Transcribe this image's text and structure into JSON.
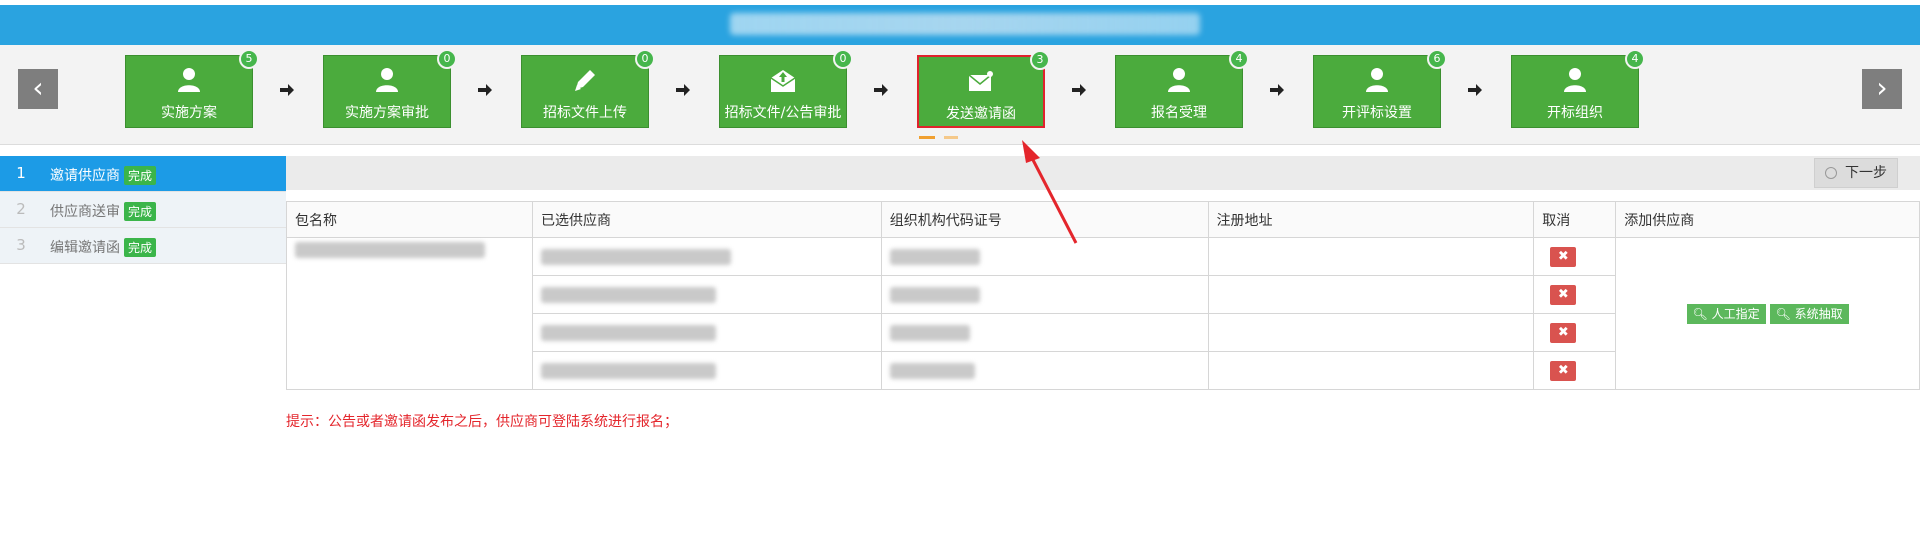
{
  "steps": [
    {
      "label": "实施方案",
      "badge": "5",
      "icon": "user-icon"
    },
    {
      "label": "实施方案审批",
      "badge": "0",
      "icon": "user-icon"
    },
    {
      "label": "招标文件上传",
      "badge": "0",
      "icon": "pencil-icon"
    },
    {
      "label": "招标文件/公告审批",
      "badge": "0",
      "icon": "envelope-upload-icon"
    },
    {
      "label": "发送邀请函",
      "badge": "3",
      "icon": "envelope-icon"
    },
    {
      "label": "报名受理",
      "badge": "4",
      "icon": "user-icon"
    },
    {
      "label": "开评标设置",
      "badge": "6",
      "icon": "user-icon"
    },
    {
      "label": "开标组织",
      "badge": "4",
      "icon": "user-icon"
    }
  ],
  "nav": {
    "prev": "‹",
    "next": "›"
  },
  "sidebar": {
    "items": [
      {
        "num": "1",
        "label": "邀请供应商",
        "status": "完成"
      },
      {
        "num": "2",
        "label": "供应商送审",
        "status": "完成"
      },
      {
        "num": "3",
        "label": "编辑邀请函",
        "status": "完成"
      }
    ]
  },
  "toolbar": {
    "next_label": "下一步"
  },
  "table": {
    "headers": [
      "包名称",
      "已选供应商",
      "组织机构代码证号",
      "注册地址",
      "取消",
      "添加供应商"
    ],
    "cancel_glyph": "✖",
    "manual_label": "人工指定",
    "random_label": "系统抽取"
  },
  "tip": "提示：公告或者邀请函发布之后，供应商可登陆系统进行报名；",
  "colors": {
    "banner": "#2aa3e0",
    "step_green": "#4bab3d",
    "active_border": "#e0232d",
    "sidebar_active": "#1c9be6",
    "cancel_red": "#d9534f",
    "tip_red": "#e4262c"
  }
}
